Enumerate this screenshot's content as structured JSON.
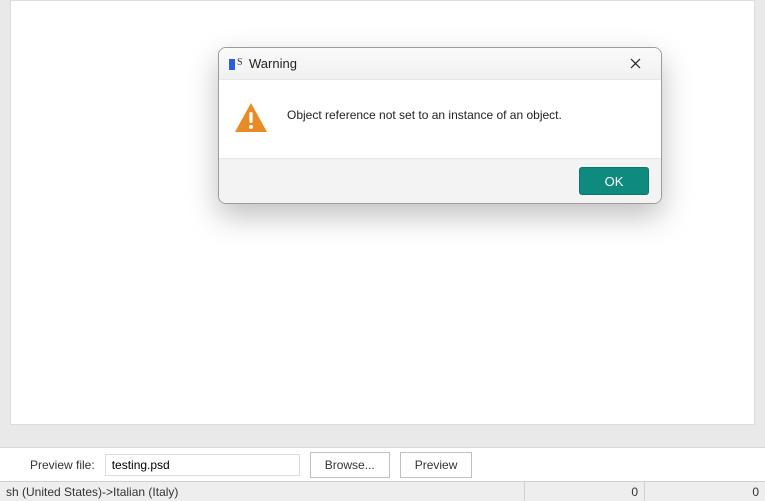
{
  "dialog": {
    "title": "Warning",
    "message": "Object reference not set to an instance of an object.",
    "ok_label": "OK"
  },
  "bottom": {
    "preview_label": "Preview file:",
    "file_value": "testing.psd",
    "browse_label": "Browse...",
    "preview_button_label": "Preview"
  },
  "status": {
    "language": "sh (United States)->Italian (Italy)",
    "count1": "0",
    "count2": "0"
  }
}
